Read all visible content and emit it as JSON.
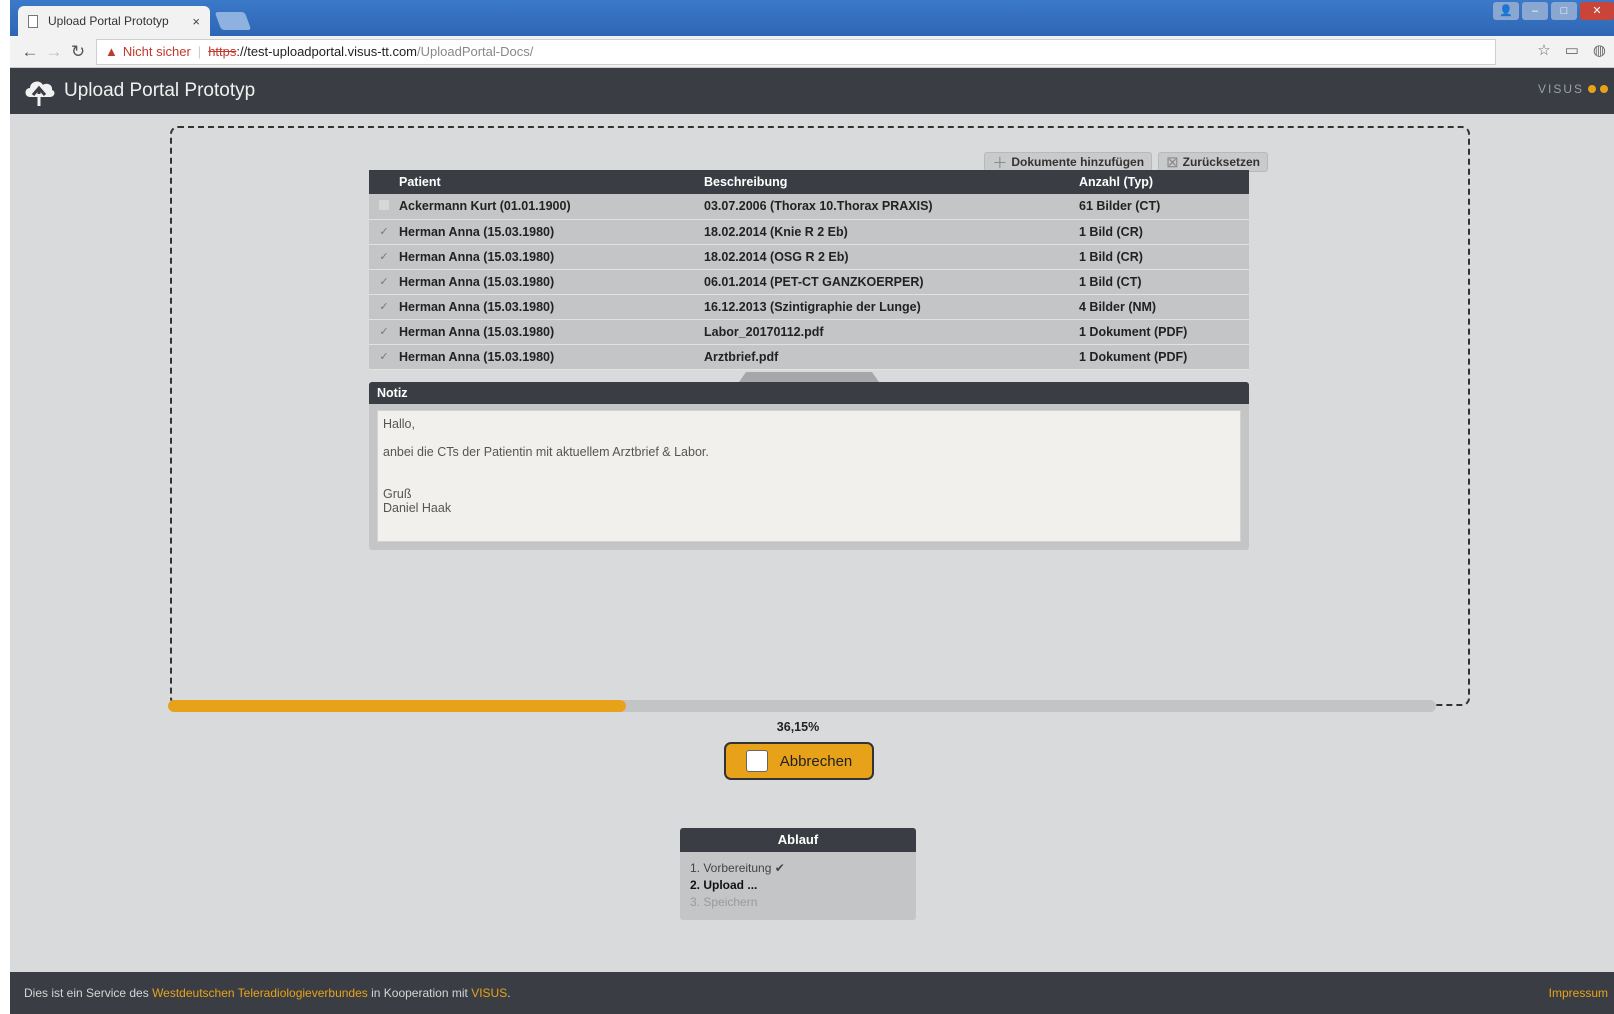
{
  "browser": {
    "tab_title": "Upload Portal Prototyp",
    "tab_close": "×",
    "security_label": "Nicht sicher",
    "url_scheme": "https",
    "url_sep": "://",
    "url_host": "test-uploadportal.visus-tt.com",
    "url_path": "/UploadPortal-Docs/"
  },
  "app": {
    "title": "Upload Portal Prototyp",
    "brand": "VISUS"
  },
  "toolbar": {
    "add_label": "Dokumente hinzufügen",
    "reset_label": "Zurücksetzen"
  },
  "table": {
    "headers": {
      "patient": "Patient",
      "description": "Beschreibung",
      "count": "Anzahl (Typ)"
    },
    "rows": [
      {
        "checked": false,
        "patient": "Ackermann Kurt (01.01.1900)",
        "description": "03.07.2006 (Thorax 10.Thorax PRAXIS)",
        "count": "61 Bilder (CT)"
      },
      {
        "checked": true,
        "patient": "Herman Anna (15.03.1980)",
        "description": "18.02.2014 (Knie R 2 Eb)",
        "count": "1 Bild (CR)"
      },
      {
        "checked": true,
        "patient": "Herman Anna (15.03.1980)",
        "description": "18.02.2014 (OSG R 2 Eb)",
        "count": "1 Bild (CR)"
      },
      {
        "checked": true,
        "patient": "Herman Anna (15.03.1980)",
        "description": "06.01.2014 (PET-CT GANZKOERPER)",
        "count": "1 Bild (CT)"
      },
      {
        "checked": true,
        "patient": "Herman Anna (15.03.1980)",
        "description": "16.12.2013 (Szintigraphie der Lunge)",
        "count": "4 Bilder (NM)"
      },
      {
        "checked": true,
        "patient": "Herman Anna (15.03.1980)",
        "description": "Labor_20170112.pdf",
        "count": "1 Dokument (PDF)"
      },
      {
        "checked": true,
        "patient": "Herman Anna (15.03.1980)",
        "description": "Arztbrief.pdf",
        "count": "1 Dokument (PDF)"
      }
    ]
  },
  "note": {
    "title": "Notiz",
    "line1": "Hallo,",
    "line2": "anbei die CTs der Patientin mit aktuellem Arztbrief & Labor.",
    "line3": "Gruß",
    "line4": "Daniel Haak"
  },
  "progress": {
    "percent": 36.15,
    "label": "36,15%"
  },
  "cancel_label": "Abbrechen",
  "steps": {
    "title": "Ablauf",
    "items": [
      {
        "label": "1. Vorbereitung",
        "suffix": "✔",
        "state": "done"
      },
      {
        "label": "2. Upload",
        "suffix": "...",
        "state": "active"
      },
      {
        "label": "3. Speichern",
        "suffix": "",
        "state": "pending"
      }
    ]
  },
  "footer": {
    "prefix": "Dies ist ein Service des ",
    "link1": "Westdeutschen Teleradiologieverbundes",
    "middle": " in Kooperation mit ",
    "link2": "VISUS",
    "suffix": ".",
    "imprint": "Impressum"
  },
  "colors": {
    "accent": "#e8a21a",
    "header_bg": "#3a3e44",
    "page_bg": "#d9dadc"
  }
}
